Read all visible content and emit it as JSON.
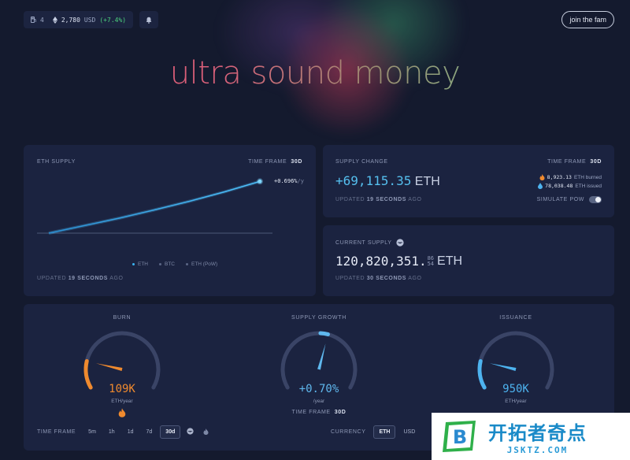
{
  "topbar": {
    "gas_value": "4",
    "eth_price": "2,780",
    "eth_price_unit": "USD",
    "eth_price_change": "(+7.4%)",
    "join_label": "join the fam"
  },
  "hero": {
    "title": "ultra sound money"
  },
  "eth_supply": {
    "label": "ETH SUPPLY",
    "timeframe_label": "TIME FRAME",
    "timeframe_value": "30d",
    "end_annotation": "+0.696%",
    "end_annotation_suffix": "/y",
    "legend": [
      "ETH",
      "BTC",
      "ETH (PoW)"
    ],
    "updated_prefix": "UPDATED",
    "updated_value": "19 SECONDS",
    "updated_suffix": "AGO",
    "chart_data": {
      "type": "line",
      "title": "ETH SUPPLY",
      "series": [
        {
          "name": "ETH",
          "x": [
            0,
            5,
            10,
            15,
            20,
            25,
            30
          ],
          "values": [
            0,
            0.095,
            0.19,
            0.295,
            0.405,
            0.525,
            0.657
          ]
        }
      ],
      "xlim": [
        0,
        30
      ],
      "ylim": [
        -0.1,
        0.72
      ],
      "legend_position": "bottom",
      "grid": false,
      "colors": {
        "ETH": "#3ab4f2"
      }
    }
  },
  "supply_change": {
    "label": "SUPPLY CHANGE",
    "timeframe_label": "TIME FRAME",
    "timeframe_value": "30d",
    "value": "+69,115.35",
    "unit": "ETH",
    "burned_value": "8,923.13",
    "burned_label": "ETH burned",
    "issued_value": "78,038.48",
    "issued_label": "ETH issued",
    "updated_prefix": "UPDATED",
    "updated_value": "19 SECONDS",
    "updated_suffix": "AGO",
    "simulate_label": "SIMULATE PoW"
  },
  "current_supply": {
    "label": "CURRENT SUPPLY",
    "value_main": "120,820,351.",
    "value_decimals_top": "86",
    "value_decimals_bottom": "54",
    "unit": "ETH",
    "updated_prefix": "UPDATED",
    "updated_value": "30 SECONDS",
    "updated_suffix": "AGO"
  },
  "gauges": {
    "burn": {
      "title": "BURN",
      "value": "109K",
      "unit": "ETH/year",
      "level": 0.18,
      "color": "#f08a2e"
    },
    "supply_growth": {
      "title": "SUPPLY GROWTH",
      "value": "+0.70%",
      "unit": "/year",
      "level": 0.56,
      "color": "#5fb8ee",
      "timeframe_label": "TIME FRAME",
      "timeframe_value": "30d"
    },
    "issuance": {
      "title": "ISSUANCE",
      "value": "950K",
      "unit": "ETH/year",
      "level": 0.18,
      "color": "#4db3ef"
    }
  },
  "bottom_controls": {
    "timeframe_label": "TIME FRAME",
    "timeframes": [
      "5m",
      "1h",
      "1d",
      "7d",
      "30d"
    ],
    "active_timeframe": "30d",
    "currency_label": "CURRENCY",
    "currencies": [
      "ETH",
      "USD"
    ],
    "active_currency": "ETH"
  },
  "watermark": {
    "cn": "开拓者奇点",
    "en": "JSKTZ.COM",
    "logo_letter": "B"
  }
}
